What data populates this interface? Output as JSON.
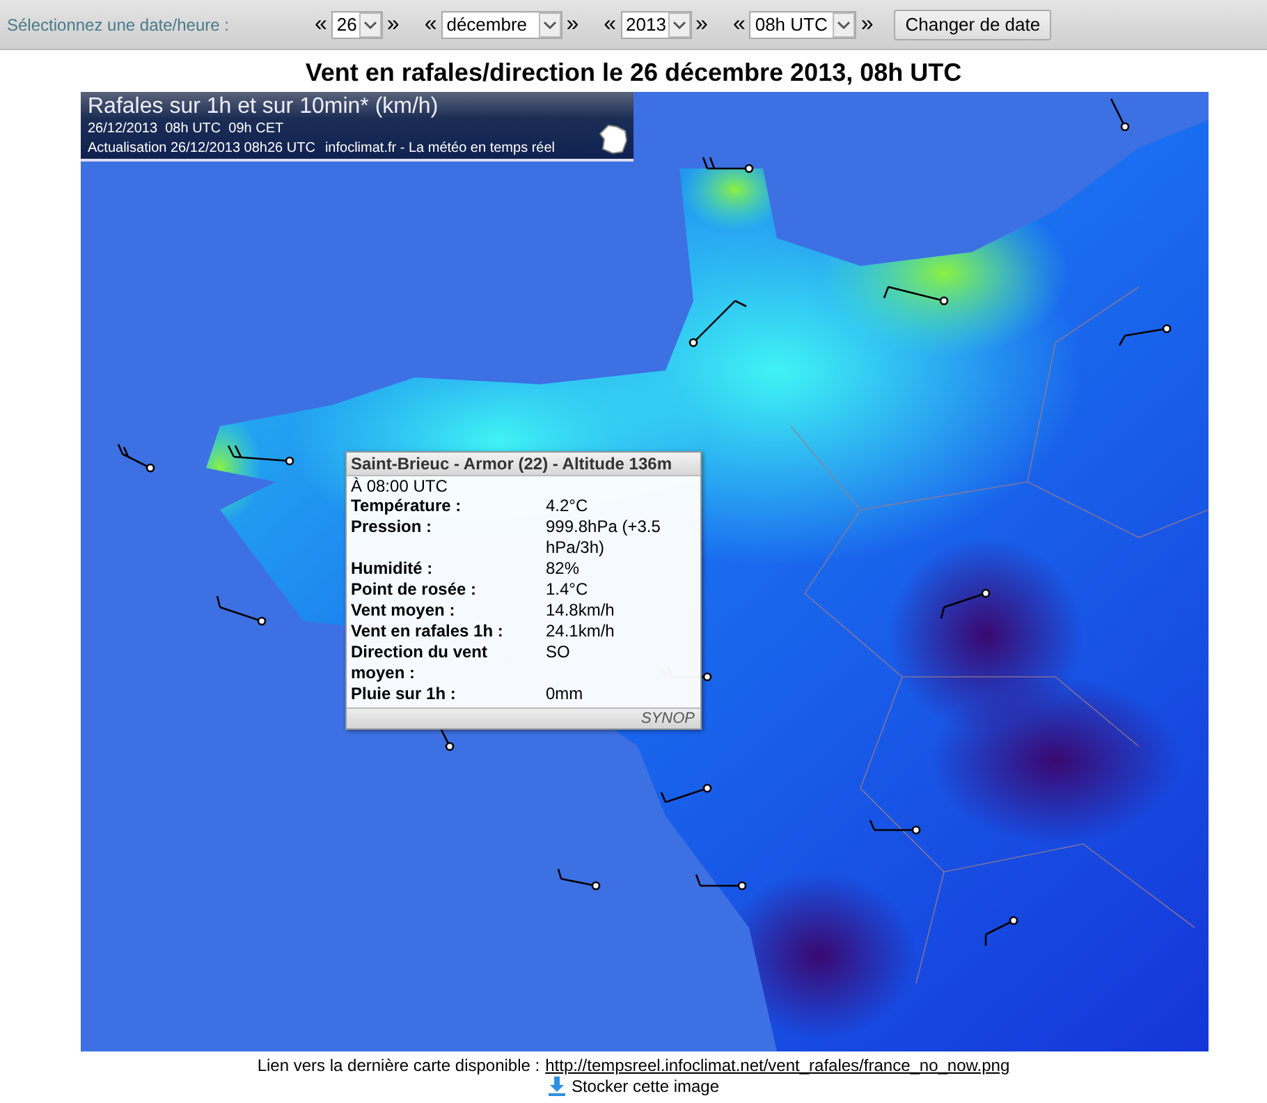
{
  "toolbar": {
    "label": "Sélectionnez une date/heure :",
    "selectors": [
      {
        "kind": "day",
        "prev": "«",
        "value": "26",
        "next": "»"
      },
      {
        "kind": "month",
        "prev": "«",
        "value": "décembre",
        "next": "»"
      },
      {
        "kind": "year",
        "prev": "«",
        "value": "2013",
        "next": "»"
      },
      {
        "kind": "hour",
        "prev": "«",
        "value": "08h UTC",
        "next": "»"
      }
    ],
    "submit": "Changer de date"
  },
  "heading": "Vent en rafales/direction le 26 décembre 2013, 08h UTC",
  "map": {
    "legend": {
      "title": "Rafales sur 1h et sur 10min* (km/h)",
      "subtitle": "26/12/2013  08h UTC  09h CET",
      "update": "Actualisation 26/12/2013 08h26 UTC",
      "credit": "infoclimat.fr - La météo en temps réel"
    },
    "tooltip": {
      "title": "Saint-Brieuc - Armor (22) - Altitude 136m",
      "time": "À 08:00 UTC",
      "rows": [
        {
          "label": "Température :",
          "value": "4.2°C"
        },
        {
          "label": "Pression :",
          "value": "999.8hPa (+3.5 hPa/3h)"
        },
        {
          "label": "Humidité :",
          "value": "82%"
        },
        {
          "label": "Point de rosée :",
          "value": "1.4°C"
        },
        {
          "label": "Vent moyen :",
          "value": "14.8km/h"
        },
        {
          "label": "Vent en rafales 1h :",
          "value": "24.1km/h"
        },
        {
          "label": "Direction du vent moyen :",
          "value": "SO"
        },
        {
          "label": "Pluie sur 1h :",
          "value": "0mm"
        }
      ],
      "source": "SYNOP"
    }
  },
  "footer": {
    "link_label": "Lien vers la dernière carte disponible :",
    "link": "http://tempsreel.infoclimat.net/vent_rafales/france_no_now.png",
    "store": "Stocker cette image"
  }
}
